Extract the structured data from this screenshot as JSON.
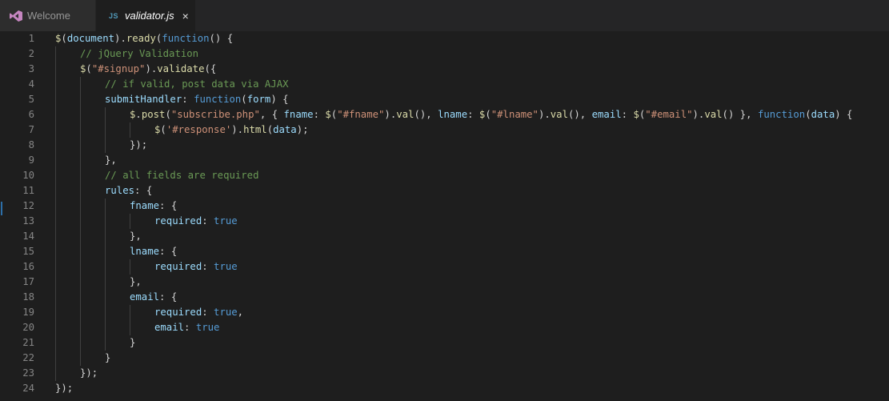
{
  "tabs": [
    {
      "label": "Welcome",
      "icon": "visual-studio-icon",
      "active": false
    },
    {
      "label": "validator.js",
      "icon": "js-file-icon",
      "icon_text": "JS",
      "active": true,
      "close_glyph": "×"
    }
  ],
  "colors": {
    "background": "#1e1e1e",
    "tabbar": "#252526",
    "line_number": "#858585",
    "function": "#dcdcaa",
    "string": "#ce9178",
    "keyword": "#569cd6",
    "comment": "#6a9955",
    "variable": "#9cdcfe",
    "punctuation": "#d4d4d4",
    "vs_icon": "#c586c0"
  },
  "editor": {
    "lines": [
      {
        "n": "1",
        "indent": 0,
        "tokens": [
          [
            "f",
            "$"
          ],
          [
            "p",
            "("
          ],
          [
            "v",
            "document"
          ],
          [
            "p",
            ")."
          ],
          [
            "f",
            "ready"
          ],
          [
            "p",
            "("
          ],
          [
            "k",
            "function"
          ],
          [
            "p",
            "() {"
          ]
        ]
      },
      {
        "n": "2",
        "indent": 1,
        "tokens": [
          [
            "c",
            "// jQuery Validation"
          ]
        ]
      },
      {
        "n": "3",
        "indent": 1,
        "tokens": [
          [
            "f",
            "$"
          ],
          [
            "p",
            "("
          ],
          [
            "s",
            "\"#signup\""
          ],
          [
            "p",
            ")."
          ],
          [
            "f",
            "validate"
          ],
          [
            "p",
            "({"
          ]
        ]
      },
      {
        "n": "4",
        "indent": 2,
        "tokens": [
          [
            "c",
            "// if valid, post data via AJAX"
          ]
        ]
      },
      {
        "n": "5",
        "indent": 2,
        "tokens": [
          [
            "v",
            "submitHandler"
          ],
          [
            "p",
            ": "
          ],
          [
            "k",
            "function"
          ],
          [
            "p",
            "("
          ],
          [
            "v",
            "form"
          ],
          [
            "p",
            ") {"
          ]
        ]
      },
      {
        "n": "6",
        "indent": 3,
        "tokens": [
          [
            "f",
            "$"
          ],
          [
            "p",
            "."
          ],
          [
            "f",
            "post"
          ],
          [
            "p",
            "("
          ],
          [
            "s",
            "\"subscribe.php\""
          ],
          [
            "p",
            ", { "
          ],
          [
            "v",
            "fname"
          ],
          [
            "p",
            ": "
          ],
          [
            "f",
            "$"
          ],
          [
            "p",
            "("
          ],
          [
            "s",
            "\"#fname\""
          ],
          [
            "p",
            ")."
          ],
          [
            "f",
            "val"
          ],
          [
            "p",
            "(), "
          ],
          [
            "v",
            "lname"
          ],
          [
            "p",
            ": "
          ],
          [
            "f",
            "$"
          ],
          [
            "p",
            "("
          ],
          [
            "s",
            "\"#lname\""
          ],
          [
            "p",
            ")."
          ],
          [
            "f",
            "val"
          ],
          [
            "p",
            "(), "
          ],
          [
            "v",
            "email"
          ],
          [
            "p",
            ": "
          ],
          [
            "f",
            "$"
          ],
          [
            "p",
            "("
          ],
          [
            "s",
            "\"#email\""
          ],
          [
            "p",
            ")."
          ],
          [
            "f",
            "val"
          ],
          [
            "p",
            "() }, "
          ],
          [
            "k",
            "function"
          ],
          [
            "p",
            "("
          ],
          [
            "v",
            "data"
          ],
          [
            "p",
            ") {"
          ]
        ]
      },
      {
        "n": "7",
        "indent": 4,
        "tokens": [
          [
            "f",
            "$"
          ],
          [
            "p",
            "("
          ],
          [
            "s",
            "'#response'"
          ],
          [
            "p",
            ")."
          ],
          [
            "f",
            "html"
          ],
          [
            "p",
            "("
          ],
          [
            "v",
            "data"
          ],
          [
            "p",
            ");"
          ]
        ]
      },
      {
        "n": "8",
        "indent": 3,
        "tokens": [
          [
            "p",
            "});"
          ]
        ]
      },
      {
        "n": "9",
        "indent": 2,
        "tokens": [
          [
            "p",
            "},"
          ]
        ]
      },
      {
        "n": "10",
        "indent": 2,
        "tokens": [
          [
            "c",
            "// all fields are required"
          ]
        ]
      },
      {
        "n": "11",
        "indent": 2,
        "tokens": [
          [
            "v",
            "rules"
          ],
          [
            "p",
            ": {"
          ]
        ]
      },
      {
        "n": "12",
        "indent": 3,
        "tokens": [
          [
            "v",
            "fname"
          ],
          [
            "p",
            ": {"
          ]
        ]
      },
      {
        "n": "13",
        "indent": 4,
        "tokens": [
          [
            "v",
            "required"
          ],
          [
            "p",
            ": "
          ],
          [
            "k",
            "true"
          ]
        ]
      },
      {
        "n": "14",
        "indent": 3,
        "tokens": [
          [
            "p",
            "},"
          ]
        ]
      },
      {
        "n": "15",
        "indent": 3,
        "tokens": [
          [
            "v",
            "lname"
          ],
          [
            "p",
            ": {"
          ]
        ]
      },
      {
        "n": "16",
        "indent": 4,
        "tokens": [
          [
            "v",
            "required"
          ],
          [
            "p",
            ": "
          ],
          [
            "k",
            "true"
          ]
        ]
      },
      {
        "n": "17",
        "indent": 3,
        "tokens": [
          [
            "p",
            "},"
          ]
        ]
      },
      {
        "n": "18",
        "indent": 3,
        "tokens": [
          [
            "v",
            "email"
          ],
          [
            "p",
            ": {"
          ]
        ]
      },
      {
        "n": "19",
        "indent": 4,
        "tokens": [
          [
            "v",
            "required"
          ],
          [
            "p",
            ": "
          ],
          [
            "k",
            "true"
          ],
          [
            "p",
            ","
          ]
        ]
      },
      {
        "n": "20",
        "indent": 4,
        "tokens": [
          [
            "v",
            "email"
          ],
          [
            "p",
            ": "
          ],
          [
            "k",
            "true"
          ]
        ]
      },
      {
        "n": "21",
        "indent": 3,
        "tokens": [
          [
            "p",
            "}"
          ]
        ]
      },
      {
        "n": "22",
        "indent": 2,
        "tokens": [
          [
            "p",
            "}"
          ]
        ]
      },
      {
        "n": "23",
        "indent": 1,
        "tokens": [
          [
            "p",
            "});"
          ]
        ]
      },
      {
        "n": "24",
        "indent": 0,
        "tokens": [
          [
            "p",
            "});"
          ]
        ]
      }
    ]
  }
}
